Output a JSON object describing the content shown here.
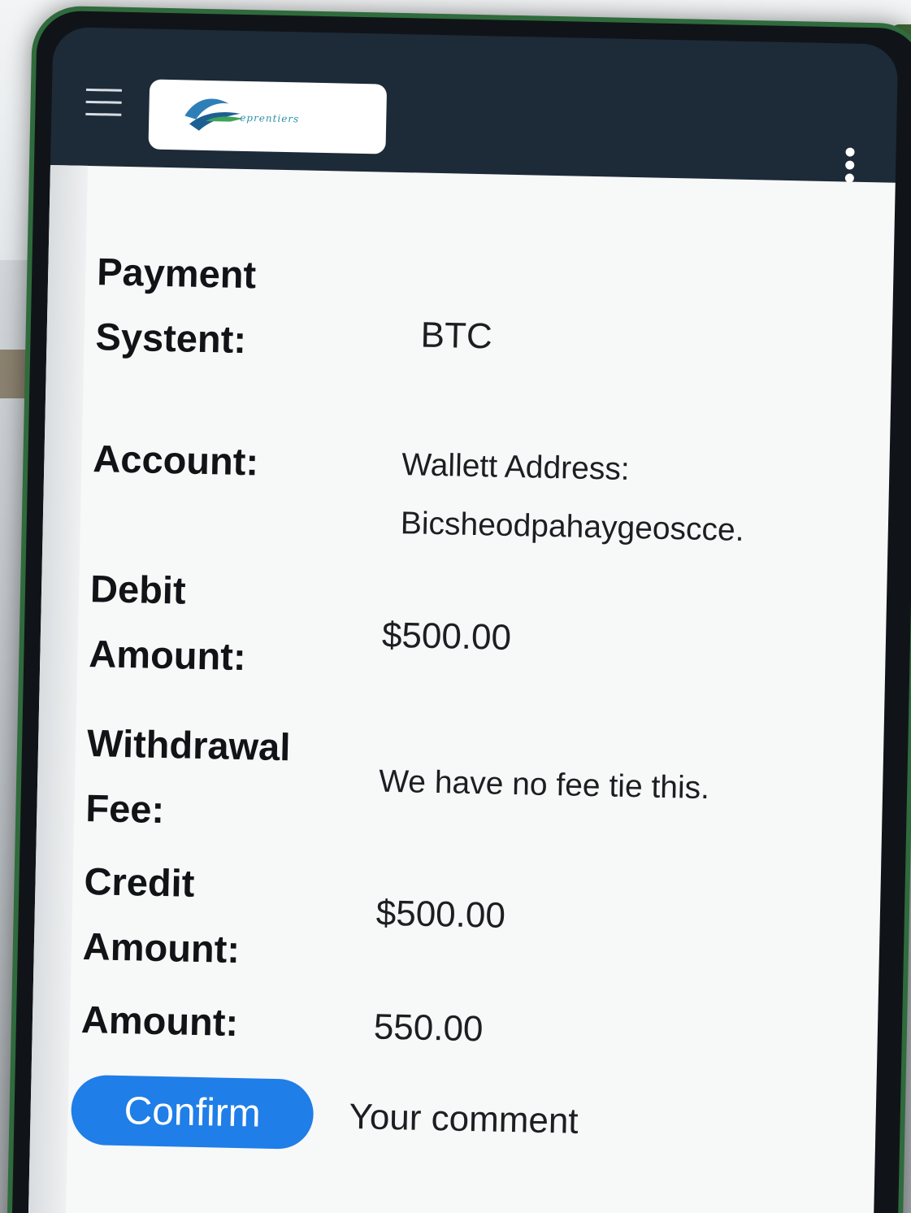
{
  "header": {
    "menu_icon": "hamburger-icon",
    "logo_text": "eprentiers",
    "overflow_icon": "kebab-menu-icon"
  },
  "form": {
    "payment_system": {
      "label_line1": "Payment",
      "label_line2": "Systent:",
      "value": "BTC"
    },
    "account": {
      "label": "Account:",
      "value_line1": "Wallett Address:",
      "value_line2": "Bicsheodpahaygeoscce."
    },
    "debit_amount": {
      "label_line1": "Debit",
      "label_line2": "Amount:",
      "value": "$500.00"
    },
    "withdrawal_fee": {
      "label_line1": "Withdrawal",
      "label_line2": "Fee:",
      "value": "We have no fee tie this."
    },
    "credit_amount": {
      "label_line1": "Credit",
      "label_line2": "Amount:",
      "value": "$500.00"
    },
    "amount": {
      "label": "Amount:",
      "value": "550.00"
    }
  },
  "actions": {
    "confirm_label": "Confirm",
    "comment_placeholder": "Your comment"
  },
  "colors": {
    "topbar": "#1d2a38",
    "confirm_button": "#1f7ee8",
    "phone_frame": "#2f6b3c"
  }
}
